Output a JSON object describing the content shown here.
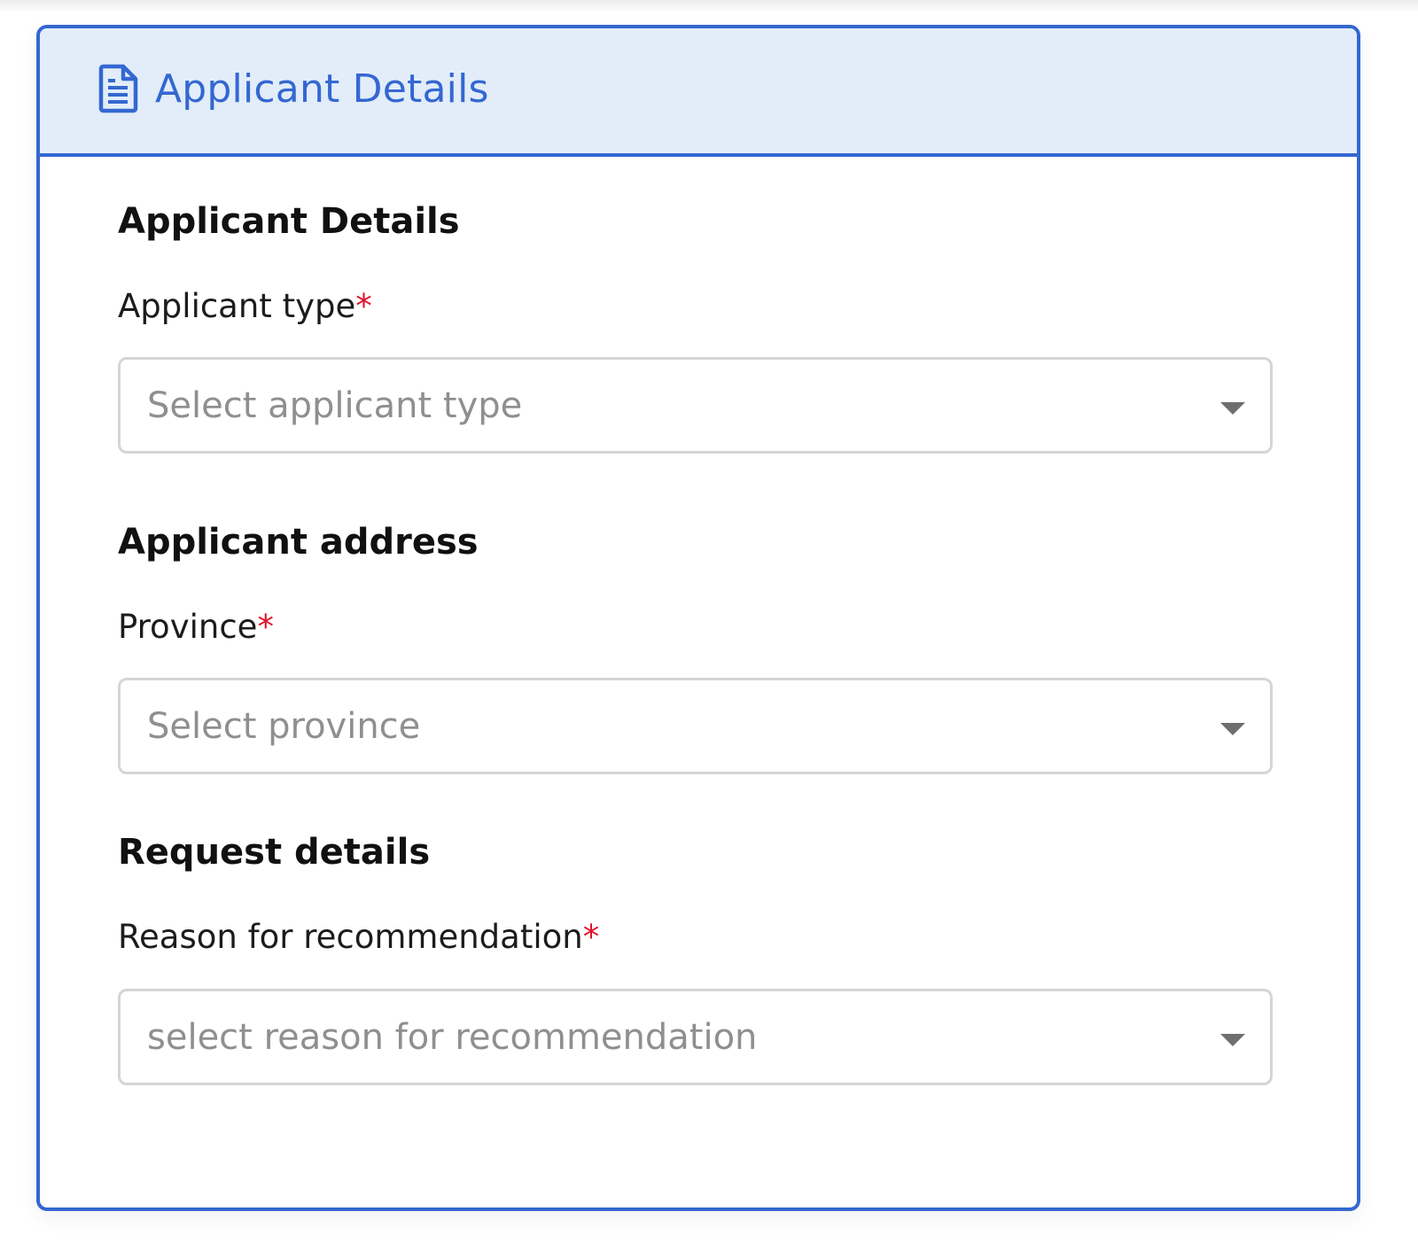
{
  "panel": {
    "title": "Applicant Details",
    "icon": "document-icon",
    "accent_color": "#3467d1",
    "header_bg": "#e2edf9"
  },
  "sections": [
    {
      "heading": "Applicant Details",
      "field": {
        "label": "Applicant type",
        "required_marker": "*",
        "placeholder": "Select applicant type"
      }
    },
    {
      "heading": "Applicant address",
      "field": {
        "label": "Province",
        "required_marker": "*",
        "placeholder": "Select province"
      }
    },
    {
      "heading": "Request details",
      "field": {
        "label": "Reason for recommendation",
        "required_marker": "*",
        "placeholder": "select reason for recommendation"
      }
    }
  ],
  "required_color": "#e0142b"
}
